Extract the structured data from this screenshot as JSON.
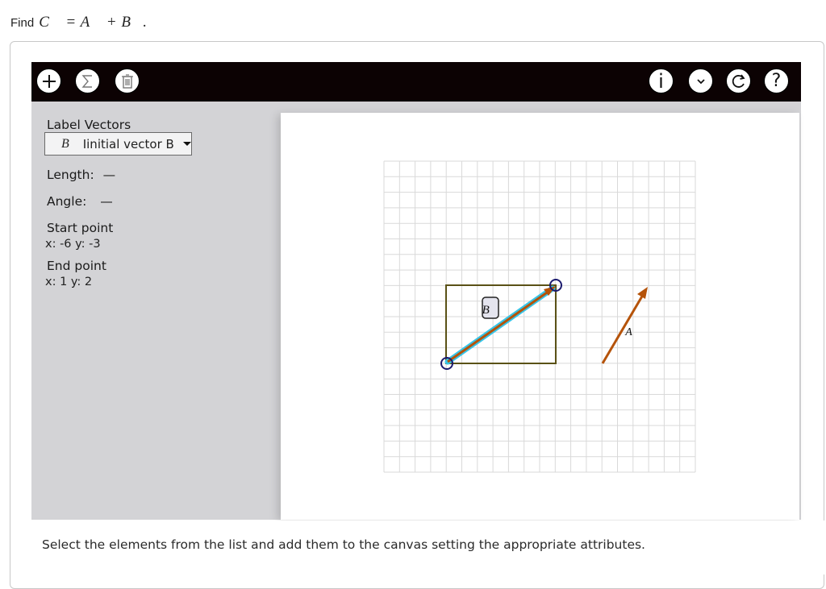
{
  "question": {
    "prefix": "Find",
    "formula": "C⃗ = A⃗ + B⃗."
  },
  "toolbar": {
    "left_buttons": [
      "add-icon",
      "sum-icon",
      "trash-icon"
    ],
    "right_buttons": [
      "info-icon",
      "chevron-down-icon",
      "reset-icon",
      "help-icon"
    ],
    "info_glyph": "i",
    "help_glyph": "?"
  },
  "sidebar": {
    "label_vectors": "Label Vectors",
    "dropdown_symbol": "B⃗",
    "dropdown_value": "Iinitial vector B",
    "length_label": "Length:",
    "length_value": "—",
    "angle_label": "Angle:",
    "angle_value": "—",
    "start_point_label": "Start point",
    "start_point_value": "x: -6 y: -3",
    "end_point_label": "End point",
    "end_point_value": "x: 1 y: 2"
  },
  "canvas": {
    "grid_columns": 20,
    "grid_rows": 20,
    "vector_b_label": "B⃗",
    "vector_a_label": "A⃗",
    "vector_b_start": [
      -6,
      -3
    ],
    "vector_b_end": [
      1,
      2
    ],
    "colors": {
      "vector": "#b5530a",
      "highlight": "#36c5e8",
      "bounding_box": "#5a5116",
      "handle": "#1b1a6e",
      "grid": "#d9d9d9"
    }
  },
  "footer": {
    "instruction": "Select the elements from the list and add them to the canvas setting the appropriate attributes."
  }
}
